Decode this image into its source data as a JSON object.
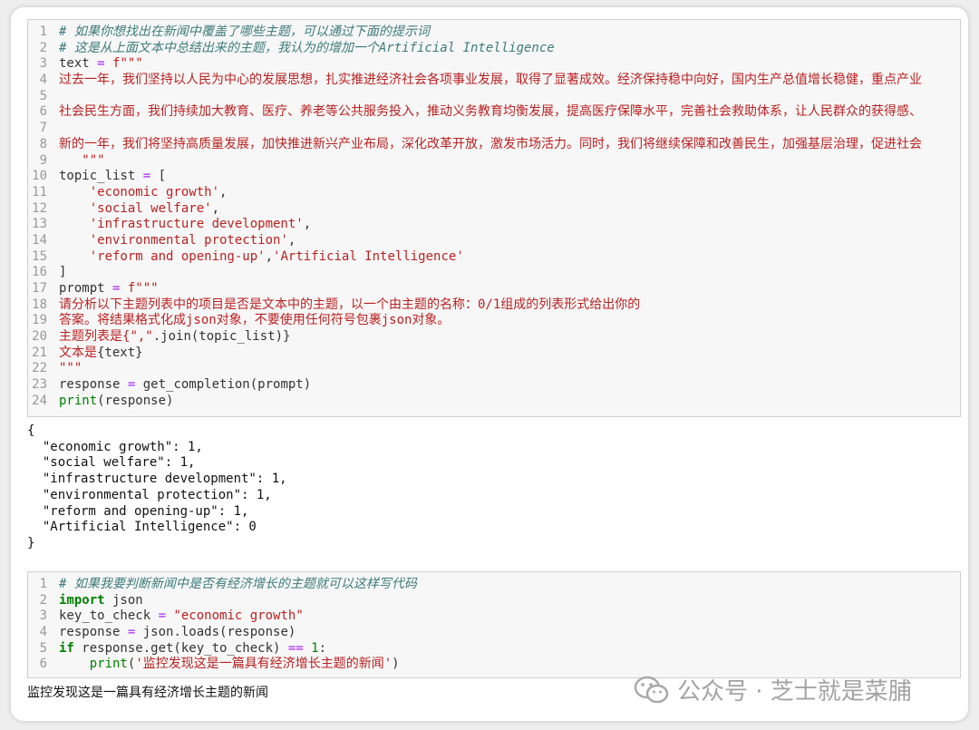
{
  "cell1": {
    "lines": [
      {
        "n": "1",
        "parts": [
          {
            "t": "# 如果你想找出在新闻中覆盖了哪些主题，可以通过下面的提示词",
            "c": "cm"
          }
        ]
      },
      {
        "n": "2",
        "parts": [
          {
            "t": "# 这是从上面文本中总结出来的主题，我认为的增加一个Artificial Intelligence",
            "c": "cm"
          }
        ]
      },
      {
        "n": "3",
        "parts": [
          {
            "t": "text ",
            "c": ""
          },
          {
            "t": "=",
            "c": "op"
          },
          {
            "t": " f\"\"\"",
            "c": "st"
          }
        ]
      },
      {
        "n": "4",
        "parts": [
          {
            "t": "过去一年，我们坚持以人民为中心的发展思想，扎实推进经济社会各项事业发展，取得了显著成效。经济保持稳中向好，国内生产总值增长稳健，重点产业",
            "c": "st"
          }
        ]
      },
      {
        "n": "5",
        "parts": [
          {
            "t": "",
            "c": ""
          }
        ]
      },
      {
        "n": "6",
        "parts": [
          {
            "t": "社会民生方面，我们持续加大教育、医疗、养老等公共服务投入，推动义务教育均衡发展，提高医疗保障水平，完善社会救助体系，让人民群众的获得感、",
            "c": "st"
          }
        ]
      },
      {
        "n": "7",
        "parts": [
          {
            "t": "",
            "c": ""
          }
        ]
      },
      {
        "n": "8",
        "parts": [
          {
            "t": "新的一年，我们将坚持高质量发展，加快推进新兴产业布局，深化改革开放，激发市场活力。同时，我们将继续保障和改善民生，加强基层治理，促进社会",
            "c": "st"
          }
        ]
      },
      {
        "n": "9",
        "parts": [
          {
            "t": "   \"\"\"",
            "c": "st"
          }
        ]
      },
      {
        "n": "10",
        "parts": [
          {
            "t": "topic_list ",
            "c": ""
          },
          {
            "t": "=",
            "c": "op"
          },
          {
            "t": " [",
            "c": ""
          }
        ]
      },
      {
        "n": "11",
        "parts": [
          {
            "t": "    ",
            "c": ""
          },
          {
            "t": "'economic growth'",
            "c": "st"
          },
          {
            "t": ",",
            "c": ""
          }
        ]
      },
      {
        "n": "12",
        "parts": [
          {
            "t": "    ",
            "c": ""
          },
          {
            "t": "'social welfare'",
            "c": "st"
          },
          {
            "t": ",",
            "c": ""
          }
        ]
      },
      {
        "n": "13",
        "parts": [
          {
            "t": "    ",
            "c": ""
          },
          {
            "t": "'infrastructure development'",
            "c": "st"
          },
          {
            "t": ",",
            "c": ""
          }
        ]
      },
      {
        "n": "14",
        "parts": [
          {
            "t": "    ",
            "c": ""
          },
          {
            "t": "'environmental protection'",
            "c": "st"
          },
          {
            "t": ",",
            "c": ""
          }
        ]
      },
      {
        "n": "15",
        "parts": [
          {
            "t": "    ",
            "c": ""
          },
          {
            "t": "'reform and opening-up'",
            "c": "st"
          },
          {
            "t": ",",
            "c": ""
          },
          {
            "t": "'Artificial Intelligence'",
            "c": "st"
          }
        ]
      },
      {
        "n": "16",
        "parts": [
          {
            "t": "]",
            "c": ""
          }
        ]
      },
      {
        "n": "17",
        "parts": [
          {
            "t": "prompt ",
            "c": ""
          },
          {
            "t": "=",
            "c": "op"
          },
          {
            "t": " f\"\"\"",
            "c": "st"
          }
        ]
      },
      {
        "n": "18",
        "parts": [
          {
            "t": "请分析以下主题列表中的项目是否是文本中的主题，以一个由主题的名称：0/1组成的列表形式给出你的",
            "c": "st"
          }
        ]
      },
      {
        "n": "19",
        "parts": [
          {
            "t": "答案。将结果格式化成json对象，不要使用任何符号包裹json对象。",
            "c": "st"
          }
        ]
      },
      {
        "n": "20",
        "parts": [
          {
            "t": "主题列表是{",
            "c": "st"
          },
          {
            "t": "\",\"",
            "c": "st"
          },
          {
            "t": ".join(topic_list)}",
            "c": ""
          }
        ]
      },
      {
        "n": "21",
        "parts": [
          {
            "t": "文本是",
            "c": "st"
          },
          {
            "t": "{text}",
            "c": ""
          }
        ]
      },
      {
        "n": "22",
        "parts": [
          {
            "t": "\"\"\"",
            "c": "st"
          }
        ]
      },
      {
        "n": "23",
        "parts": [
          {
            "t": "response ",
            "c": ""
          },
          {
            "t": "=",
            "c": "op"
          },
          {
            "t": " get_completion(prompt)",
            "c": ""
          }
        ]
      },
      {
        "n": "24",
        "parts": [
          {
            "t": "print",
            "c": "bi"
          },
          {
            "t": "(response)",
            "c": ""
          }
        ]
      }
    ]
  },
  "output1": "{\n  \"economic growth\": 1,\n  \"social welfare\": 1,\n  \"infrastructure development\": 1,\n  \"environmental protection\": 1,\n  \"reform and opening-up\": 1,\n  \"Artificial Intelligence\": 0\n}",
  "cell2": {
    "lines": [
      {
        "n": "1",
        "parts": [
          {
            "t": "# 如果我要判断新闻中是否有经济增长的主题就可以这样写代码",
            "c": "cm"
          }
        ]
      },
      {
        "n": "2",
        "parts": [
          {
            "t": "import",
            "c": "kw"
          },
          {
            "t": " json",
            "c": ""
          }
        ]
      },
      {
        "n": "3",
        "parts": [
          {
            "t": "key_to_check ",
            "c": ""
          },
          {
            "t": "=",
            "c": "op"
          },
          {
            "t": " ",
            "c": ""
          },
          {
            "t": "\"economic growth\"",
            "c": "st"
          }
        ]
      },
      {
        "n": "4",
        "parts": [
          {
            "t": "response ",
            "c": ""
          },
          {
            "t": "=",
            "c": "op"
          },
          {
            "t": " json.loads(response)",
            "c": ""
          }
        ]
      },
      {
        "n": "5",
        "parts": [
          {
            "t": "if",
            "c": "kw"
          },
          {
            "t": " response.get(key_to_check) ",
            "c": ""
          },
          {
            "t": "==",
            "c": "op"
          },
          {
            "t": " ",
            "c": ""
          },
          {
            "t": "1",
            "c": "nm"
          },
          {
            "t": ":",
            "c": ""
          }
        ]
      },
      {
        "n": "6",
        "parts": [
          {
            "t": "    ",
            "c": ""
          },
          {
            "t": "print",
            "c": "bi"
          },
          {
            "t": "(",
            "c": ""
          },
          {
            "t": "'监控发现这是一篇具有经济增长主题的新闻'",
            "c": "st"
          },
          {
            "t": ")",
            "c": ""
          }
        ]
      }
    ]
  },
  "output2": "监控发现这是一篇具有经济增长主题的新闻",
  "watermark": "公众号 · 芝士就是菜脯",
  "watermark_icon": "wechat-icon"
}
